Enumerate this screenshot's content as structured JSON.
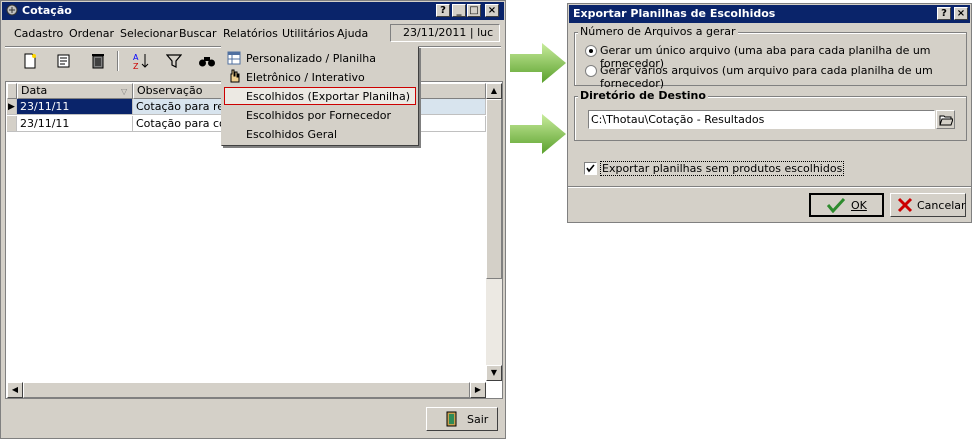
{
  "main_window": {
    "title": "Cotação",
    "title_buttons": [
      "?",
      "_",
      "□",
      "×"
    ],
    "menu": [
      "Cadastro",
      "Ordenar",
      "Selecionar",
      "Buscar",
      "Relatórios",
      "Utilitários",
      "Ajuda"
    ],
    "status": "23/11/2011 | luc",
    "toolbar_icons": [
      "new-icon",
      "edit-icon",
      "delete-icon",
      "sort-icon",
      "filter-icon",
      "find-icon"
    ],
    "grid": {
      "columns": [
        "Data",
        "Observação"
      ],
      "rows": [
        {
          "date": "23/11/11",
          "obs": "Cotação para repo"
        },
        {
          "date": "23/11/11",
          "obs": "Cotação para comp"
        }
      ]
    },
    "exit_label": "Sair"
  },
  "report_menu": {
    "items": [
      {
        "label": "Personalizado / Planilha",
        "icon": "spreadsheet-icon"
      },
      {
        "label": "Eletrônico / Interativo",
        "icon": "hand-icon"
      },
      {
        "label": "Escolhidos (Exportar Planilha)",
        "highlighted": true
      },
      {
        "label": "Escolhidos por Fornecedor"
      },
      {
        "label": "Escolhidos Geral"
      }
    ]
  },
  "export_dialog": {
    "title": "Exportar Planilhas de Escolhidos",
    "title_buttons": [
      "?",
      "×"
    ],
    "files_group": "Número de Arquivos a gerar",
    "option_single": "Gerar um único arquivo (uma aba para cada planilha de um fornecedor)",
    "option_multiple": "Gerar vários arquivos (um arquivo para cada planilha de um fornecedor)",
    "selected_option": "single",
    "dest_group": "Diretório de Destino",
    "dest_path": "C:\\Thotau\\Cotação - Resultados",
    "export_empty_label": "Exportar planilhas sem produtos escolhidos",
    "export_empty_checked": true,
    "ok_label": "OK",
    "cancel_label": "Cancelar"
  },
  "colors": {
    "title_bar": "#0a246a",
    "selection": "#0a246a",
    "highlight_border": "#cc0000",
    "arrow_green": "#7bc043"
  }
}
